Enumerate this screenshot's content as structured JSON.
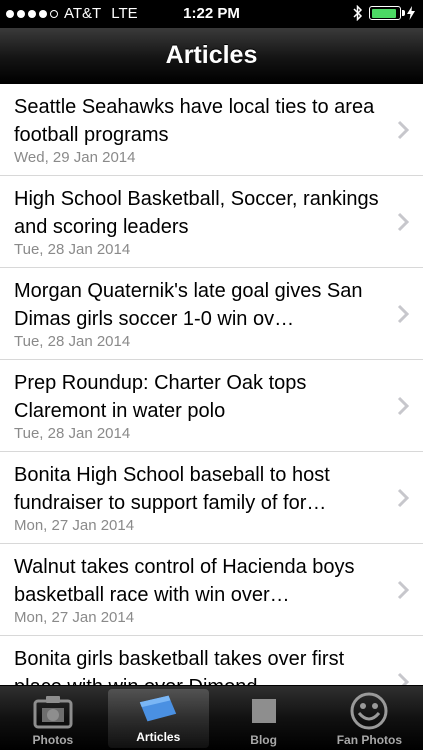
{
  "status": {
    "carrier": "AT&T",
    "network": "LTE",
    "time": "1:22 PM",
    "signal_bars": 4,
    "signal_max": 5,
    "battery_level": 0.9
  },
  "nav": {
    "title": "Articles"
  },
  "articles": [
    {
      "title": "Seattle Seahawks have local ties to area football programs",
      "date": "Wed, 29 Jan 2014"
    },
    {
      "title": "High School Basketball, Soccer, rankings and scoring leaders",
      "date": "Tue, 28 Jan 2014"
    },
    {
      "title": "Morgan Quaternik's late goal gives San Dimas girls soccer 1-0 win ov…",
      "date": "Tue, 28 Jan 2014"
    },
    {
      "title": "Prep Roundup: Charter Oak tops Claremont in water polo",
      "date": "Tue, 28 Jan 2014"
    },
    {
      "title": "Bonita High School baseball to host fundraiser to support family of for…",
      "date": "Mon, 27 Jan 2014"
    },
    {
      "title": "Walnut takes control of Hacienda boys basketball race with win over…",
      "date": "Mon, 27 Jan 2014"
    },
    {
      "title": "Bonita girls basketball takes over first place with win over Dimond…",
      "date": ""
    }
  ],
  "tabs": [
    {
      "label": "Photos",
      "icon": "camera-icon",
      "active": false
    },
    {
      "label": "Articles",
      "icon": "document-icon",
      "active": true
    },
    {
      "label": "Blog",
      "icon": "blog-square-icon",
      "active": false
    },
    {
      "label": "Fan Photos",
      "icon": "smiley-icon",
      "active": false
    }
  ],
  "colors": {
    "battery_green": "#4cd964",
    "article_icon_blue": "#4a90e2",
    "date_gray": "#8a8a8a"
  }
}
